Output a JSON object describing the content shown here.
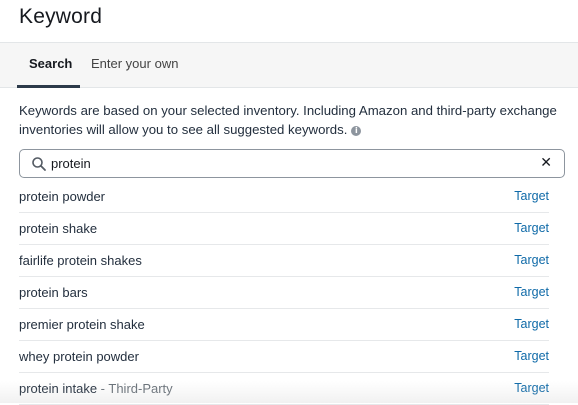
{
  "header": {
    "title": "Keyword"
  },
  "tabs": [
    {
      "label": "Search",
      "active": true
    },
    {
      "label": "Enter your own",
      "active": false
    }
  ],
  "description": {
    "text": "Keywords are based on your selected inventory. Including Amazon and third-party exchange inventories will allow you to see all suggested keywords.",
    "info_icon": "info-icon"
  },
  "search": {
    "value": "protein",
    "placeholder": "",
    "icon": "search-icon",
    "clear_icon": "close-icon"
  },
  "results": [
    {
      "keyword": "protein powder",
      "suffix": "",
      "action": "Target"
    },
    {
      "keyword": "protein shake",
      "suffix": "",
      "action": "Target"
    },
    {
      "keyword": "fairlife protein shakes",
      "suffix": "",
      "action": "Target"
    },
    {
      "keyword": "protein bars",
      "suffix": "",
      "action": "Target"
    },
    {
      "keyword": "premier protein shake",
      "suffix": "",
      "action": "Target"
    },
    {
      "keyword": "whey protein powder",
      "suffix": "",
      "action": "Target"
    },
    {
      "keyword": "protein intake",
      "suffix": " - Third-Party",
      "action": "Target"
    }
  ],
  "colors": {
    "link": "#0f6aa8",
    "text": "#232f3e",
    "tab_underline": "#2c3a4a"
  }
}
